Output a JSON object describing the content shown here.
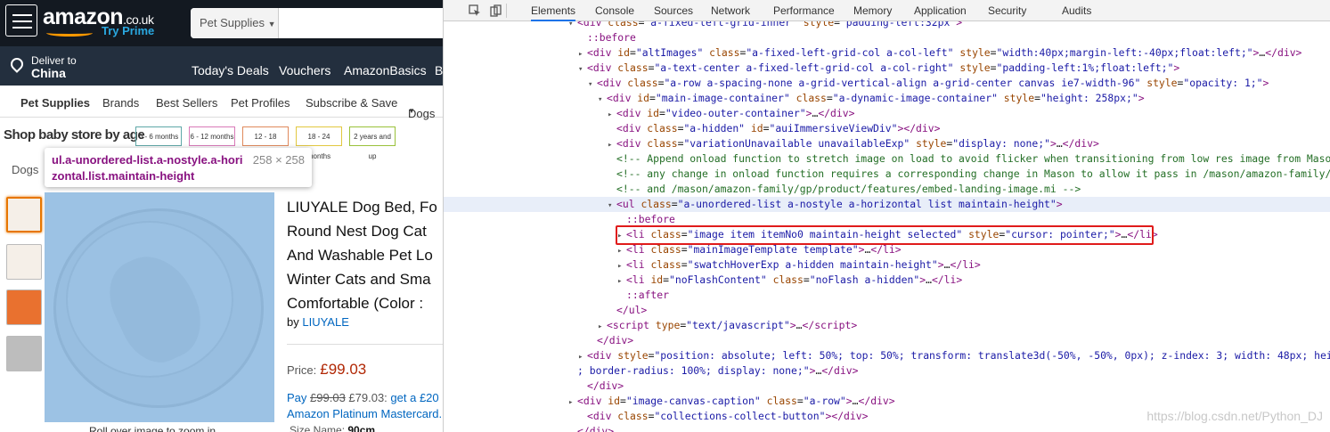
{
  "amazon": {
    "logo_main": "amazon",
    "logo_suffix": ".co.uk",
    "try_prime": "Try Prime",
    "search_category": "Pet Supplies",
    "deliver_to": "Deliver to",
    "deliver_country": "China",
    "nav": [
      "Today's Deals",
      "Vouchers",
      "AmazonBasics",
      "B"
    ],
    "subnav": [
      "Pet Supplies",
      "Brands",
      "Best Sellers",
      "Pet Profiles",
      "Subscribe & Save",
      "Dogs"
    ],
    "baby_store_title": "Shop baby store by age",
    "age_buttons": [
      {
        "label": "0 - 6 months",
        "color": "#5fa8a8"
      },
      {
        "label": "6 - 12 months",
        "color": "#d97ab8"
      },
      {
        "label": "12 - 18 months",
        "color": "#e08a5c"
      },
      {
        "label": "18 - 24 months",
        "color": "#e2c840"
      },
      {
        "label": "2 years and up",
        "color": "#9ac13a"
      }
    ],
    "breadcrumb": "Dogs",
    "tooltip": {
      "selector": "ul.a-unordered-list.a-nostyle.a-horizontal.list.maintain-height",
      "size": "258 × 258"
    },
    "product_title_lines": [
      "LIUYALE Dog Bed, Fo",
      "Round Nest Dog Cat",
      "And Washable Pet Lo",
      "Winter Cats and Sma",
      "Comfortable (Color :"
    ],
    "by_label": "by",
    "brand": "LIUYALE",
    "price_label": "Price:",
    "price": "£99.03",
    "pay_prefix": "Pay",
    "pay_old": "£99.03",
    "pay_new": "£79.03:",
    "pay_rest": "get a £20",
    "card_line": "Amazon Platinum Mastercard.",
    "size_label": "Size Name:",
    "size_value": "90cm",
    "zoom_hint": "Roll over image to zoom in"
  },
  "devtools": {
    "tabs": [
      "Elements",
      "Console",
      "Sources",
      "Network",
      "Performance",
      "Memory",
      "Application",
      "Security",
      "Audits"
    ],
    "active_tab": "Elements",
    "watermark": "https://blog.csdn.net/Python_DJ"
  }
}
